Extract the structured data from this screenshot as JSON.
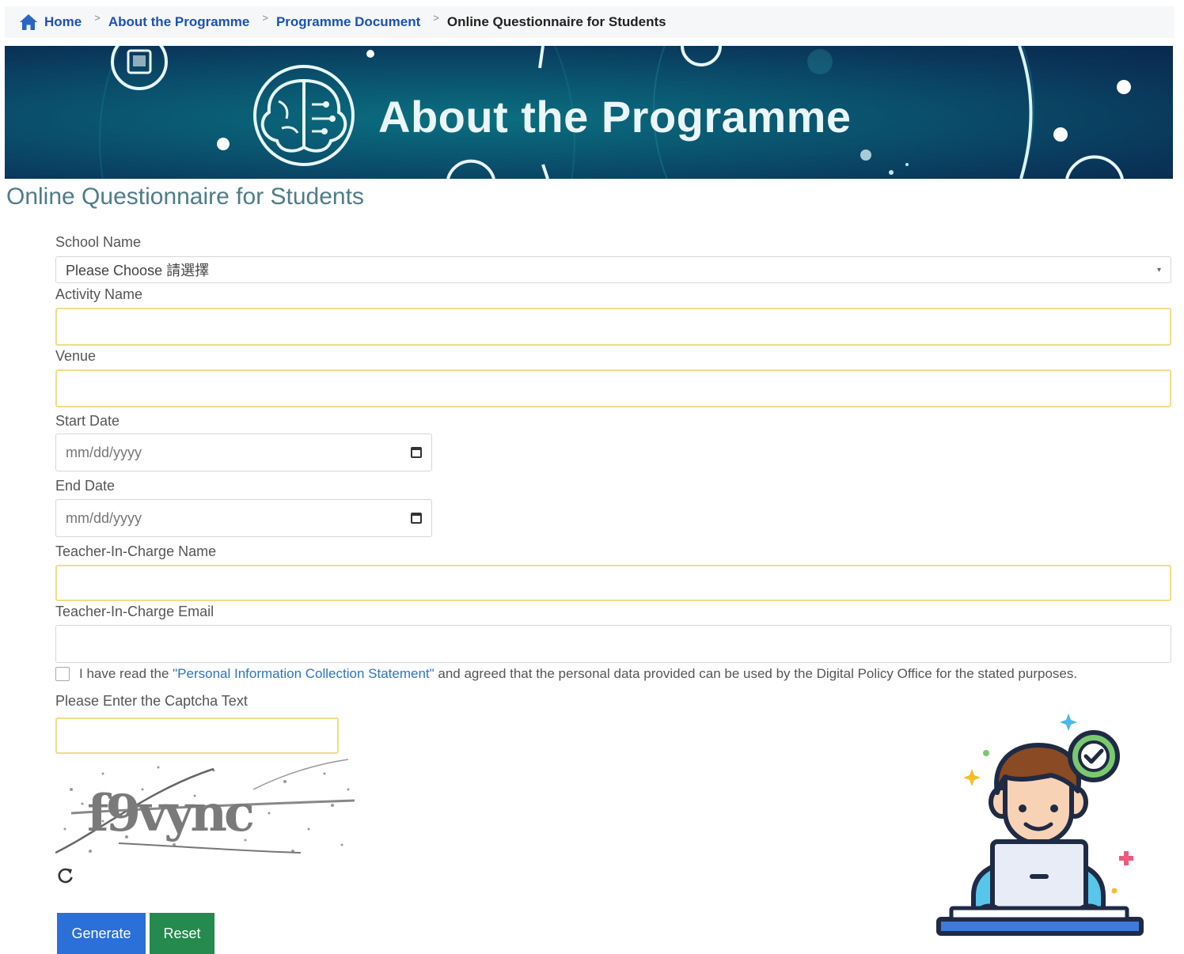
{
  "breadcrumb": {
    "items": [
      {
        "label": "Home"
      },
      {
        "label": "About the Programme"
      },
      {
        "label": "Programme Document"
      },
      {
        "label": "Online Questionnaire for Students"
      }
    ]
  },
  "banner": {
    "title": "About the Programme"
  },
  "page": {
    "title": "Online Questionnaire for Students"
  },
  "form": {
    "school_name": {
      "label": "School Name",
      "value": "Please Choose 請選擇"
    },
    "activity_name": {
      "label": "Activity Name",
      "value": ""
    },
    "venue": {
      "label": "Venue",
      "value": ""
    },
    "start_date": {
      "label": "Start Date",
      "placeholder": "mm/dd/yyyy"
    },
    "end_date": {
      "label": "End Date",
      "placeholder": "mm/dd/yyyy"
    },
    "teacher_name": {
      "label": "Teacher-In-Charge Name",
      "value": ""
    },
    "teacher_email": {
      "label": "Teacher-In-Charge Email",
      "value": ""
    },
    "consent": {
      "prefix": "I have read the ",
      "link": "\"Personal Information Collection Statement\"",
      "suffix": " and agreed that the personal data provided can be used by the Digital Policy Office for the stated purposes."
    },
    "captcha": {
      "label": "Please Enter the Captcha Text",
      "image_text": "f9vync"
    }
  },
  "buttons": {
    "generate": "Generate",
    "reset": "Reset"
  },
  "colors": {
    "link_blue": "#1b52b8",
    "title_teal": "#4e7c8a",
    "generate_blue": "#2b6fd9",
    "reset_green": "#248a4d",
    "required_border": "#f1dc8a"
  }
}
